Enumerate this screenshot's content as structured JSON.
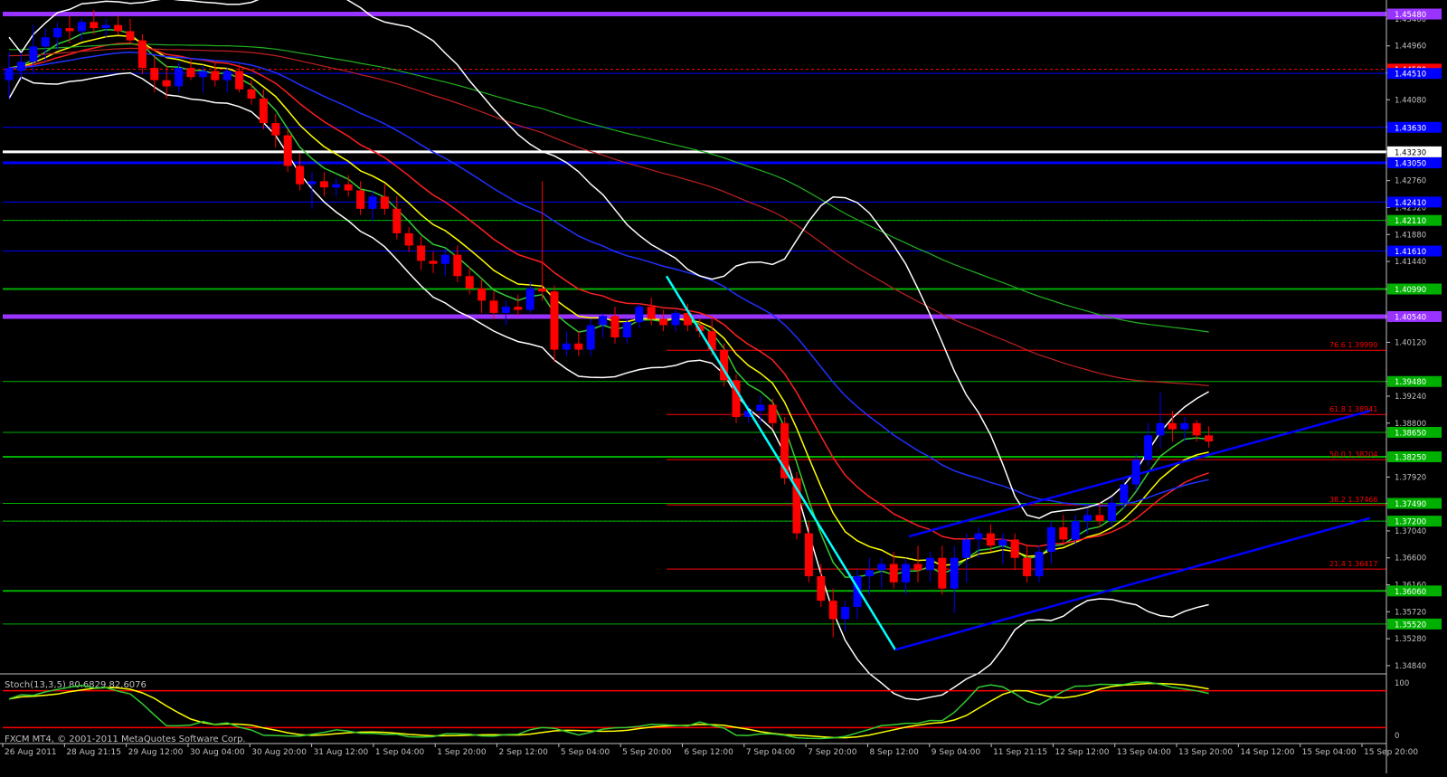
{
  "platform": {
    "watermark": "FXCM MT4, © 2001-2011 MetaQuotes Software Corp."
  },
  "colors": {
    "background": "#000000",
    "bull_candle": "#0000ff",
    "bear_candle": "#ff0000",
    "purple_level": "#9933ff",
    "blue_level": "#0000ff",
    "green_level": "#00b000",
    "white_level": "#ffffff",
    "fib_line": "#ff0000",
    "trendline_cyan": "#00ffff",
    "channel_blue": "#0000ff",
    "stoch_main": "#32cd32",
    "stoch_signal": "#ffff00"
  },
  "chart_data": [
    {
      "type": "candlestick",
      "grid": false,
      "ylim": [
        1.3475,
        1.4565
      ],
      "price_ticks": [
        "1.45400",
        "1.44960",
        "1.44520",
        "1.44080",
        "1.43640",
        "1.43230",
        "1.42760",
        "1.42320",
        "1.41880",
        "1.41440",
        "1.40990",
        "1.40540",
        "1.40120",
        "1.39480",
        "1.39240",
        "1.38800",
        "1.37920",
        "1.37490",
        "1.37040",
        "1.36600",
        "1.36160",
        "1.35720",
        "1.35280",
        "1.34840"
      ],
      "time_labels": [
        "26 Aug 2011",
        "28 Aug 21:15",
        "29 Aug 12:00",
        "30 Aug 04:00",
        "30 Aug 20:00",
        "31 Aug 12:00",
        "1 Sep 04:00",
        "1 Sep 20:00",
        "2 Sep 12:00",
        "5 Sep 04:00",
        "5 Sep 20:00",
        "6 Sep 12:00",
        "7 Sep 04:00",
        "7 Sep 20:00",
        "8 Sep 12:00",
        "9 Sep 04:00",
        "11 Sep 21:15",
        "12 Sep 12:00",
        "13 Sep 04:00",
        "13 Sep 20:00",
        "14 Sep 12:00",
        "15 Sep 04:00",
        "15 Sep 20:00"
      ],
      "candles": [
        [
          1.444,
          1.4485,
          1.441,
          1.446
        ],
        [
          1.4455,
          1.4485,
          1.444,
          1.447
        ],
        [
          1.447,
          1.453,
          1.445,
          1.4495
        ],
        [
          1.4495,
          1.4525,
          1.447,
          1.451
        ],
        [
          1.451,
          1.4535,
          1.449,
          1.4525
        ],
        [
          1.4525,
          1.4545,
          1.45,
          1.452
        ],
        [
          1.452,
          1.454,
          1.4505,
          1.4535
        ],
        [
          1.4535,
          1.4555,
          1.4515,
          1.4525
        ],
        [
          1.4525,
          1.454,
          1.451,
          1.453
        ],
        [
          1.453,
          1.4545,
          1.4515,
          1.452
        ],
        [
          1.452,
          1.454,
          1.45,
          1.4505
        ],
        [
          1.4505,
          1.4515,
          1.445,
          1.446
        ],
        [
          1.446,
          1.448,
          1.442,
          1.444
        ],
        [
          1.444,
          1.4465,
          1.441,
          1.443
        ],
        [
          1.443,
          1.447,
          1.442,
          1.446
        ],
        [
          1.446,
          1.4475,
          1.444,
          1.4445
        ],
        [
          1.4445,
          1.4465,
          1.442,
          1.4455
        ],
        [
          1.4455,
          1.447,
          1.443,
          1.444
        ],
        [
          1.444,
          1.446,
          1.442,
          1.4455
        ],
        [
          1.4455,
          1.4465,
          1.442,
          1.4425
        ],
        [
          1.4425,
          1.444,
          1.44,
          1.441
        ],
        [
          1.441,
          1.4425,
          1.436,
          1.437
        ],
        [
          1.437,
          1.4385,
          1.433,
          1.435
        ],
        [
          1.435,
          1.436,
          1.429,
          1.43
        ],
        [
          1.43,
          1.432,
          1.426,
          1.427
        ],
        [
          1.427,
          1.429,
          1.423,
          1.4275
        ],
        [
          1.4275,
          1.429,
          1.425,
          1.4265
        ],
        [
          1.4265,
          1.428,
          1.425,
          1.427
        ],
        [
          1.427,
          1.4285,
          1.425,
          1.426
        ],
        [
          1.426,
          1.4275,
          1.422,
          1.423
        ],
        [
          1.423,
          1.426,
          1.421,
          1.425
        ],
        [
          1.425,
          1.427,
          1.422,
          1.423
        ],
        [
          1.423,
          1.425,
          1.418,
          1.419
        ],
        [
          1.419,
          1.42,
          1.416,
          1.417
        ],
        [
          1.417,
          1.4185,
          1.413,
          1.4145
        ],
        [
          1.4145,
          1.416,
          1.4125,
          1.414
        ],
        [
          1.414,
          1.4165,
          1.412,
          1.4155
        ],
        [
          1.4155,
          1.417,
          1.411,
          1.412
        ],
        [
          1.412,
          1.4135,
          1.409,
          1.41
        ],
        [
          1.41,
          1.4115,
          1.406,
          1.408
        ],
        [
          1.408,
          1.4095,
          1.405,
          1.406
        ],
        [
          1.406,
          1.408,
          1.404,
          1.407
        ],
        [
          1.407,
          1.409,
          1.4055,
          1.4065
        ],
        [
          1.4065,
          1.411,
          1.406,
          1.41
        ],
        [
          1.41,
          1.4275,
          1.408,
          1.4095
        ],
        [
          1.4095,
          1.4105,
          1.398,
          1.4
        ],
        [
          1.4,
          1.403,
          1.399,
          1.401
        ],
        [
          1.401,
          1.403,
          1.399,
          1.4
        ],
        [
          1.4,
          1.405,
          1.399,
          1.404
        ],
        [
          1.404,
          1.406,
          1.402,
          1.4055
        ],
        [
          1.4055,
          1.407,
          1.401,
          1.402
        ],
        [
          1.402,
          1.405,
          1.401,
          1.4045
        ],
        [
          1.4045,
          1.4075,
          1.4035,
          1.407
        ],
        [
          1.407,
          1.4085,
          1.404,
          1.405
        ],
        [
          1.405,
          1.4065,
          1.403,
          1.404
        ],
        [
          1.404,
          1.4065,
          1.403,
          1.406
        ],
        [
          1.406,
          1.4075,
          1.403,
          1.404
        ],
        [
          1.404,
          1.405,
          1.402,
          1.403
        ],
        [
          1.403,
          1.405,
          1.399,
          1.4
        ],
        [
          1.4,
          1.401,
          1.394,
          1.395
        ],
        [
          1.395,
          1.396,
          1.388,
          1.389
        ],
        [
          1.389,
          1.391,
          1.388,
          1.39
        ],
        [
          1.39,
          1.3925,
          1.388,
          1.391
        ],
        [
          1.391,
          1.392,
          1.387,
          1.388
        ],
        [
          1.388,
          1.389,
          1.378,
          1.379
        ],
        [
          1.379,
          1.38,
          1.369,
          1.37
        ],
        [
          1.37,
          1.372,
          1.362,
          1.363
        ],
        [
          1.363,
          1.365,
          1.358,
          1.359
        ],
        [
          1.359,
          1.361,
          1.353,
          1.356
        ],
        [
          1.356,
          1.359,
          1.354,
          1.358
        ],
        [
          1.358,
          1.364,
          1.356,
          1.363
        ],
        [
          1.363,
          1.366,
          1.36,
          1.364
        ],
        [
          1.364,
          1.366,
          1.361,
          1.365
        ],
        [
          1.365,
          1.367,
          1.361,
          1.362
        ],
        [
          1.362,
          1.366,
          1.36,
          1.365
        ],
        [
          1.365,
          1.368,
          1.362,
          1.364
        ],
        [
          1.364,
          1.367,
          1.362,
          1.366
        ],
        [
          1.366,
          1.368,
          1.36,
          1.361
        ],
        [
          1.361,
          1.368,
          1.357,
          1.366
        ],
        [
          1.366,
          1.37,
          1.362,
          1.369
        ],
        [
          1.369,
          1.371,
          1.366,
          1.37
        ],
        [
          1.37,
          1.3715,
          1.367,
          1.368
        ],
        [
          1.368,
          1.37,
          1.365,
          1.369
        ],
        [
          1.369,
          1.37,
          1.364,
          1.366
        ],
        [
          1.366,
          1.368,
          1.362,
          1.363
        ],
        [
          1.363,
          1.368,
          1.362,
          1.367
        ],
        [
          1.367,
          1.372,
          1.365,
          1.371
        ],
        [
          1.371,
          1.373,
          1.368,
          1.369
        ],
        [
          1.369,
          1.373,
          1.368,
          1.372
        ],
        [
          1.372,
          1.374,
          1.37,
          1.373
        ],
        [
          1.373,
          1.375,
          1.371,
          1.372
        ],
        [
          1.372,
          1.376,
          1.371,
          1.375
        ],
        [
          1.375,
          1.379,
          1.374,
          1.378
        ],
        [
          1.378,
          1.383,
          1.377,
          1.382
        ],
        [
          1.382,
          1.388,
          1.381,
          1.386
        ],
        [
          1.386,
          1.393,
          1.384,
          1.388
        ],
        [
          1.388,
          1.39,
          1.385,
          1.387
        ],
        [
          1.387,
          1.389,
          1.385,
          1.388
        ],
        [
          1.388,
          1.3885,
          1.385,
          1.386
        ],
        [
          1.386,
          1.3875,
          1.384,
          1.385
        ]
      ],
      "right_axis_tags": [
        {
          "price": "1.45480",
          "color": "#9933ff"
        },
        {
          "price": "1.44580",
          "color": "#ff0000"
        },
        {
          "price": "1.44510",
          "color": "#0000ff"
        },
        {
          "price": "1.43630",
          "color": "#0000ff"
        },
        {
          "price": "1.43230",
          "color": "#ffffff"
        },
        {
          "price": "1.43050",
          "color": "#0000ff"
        },
        {
          "price": "1.42410",
          "color": "#0000ff"
        },
        {
          "price": "1.42110",
          "color": "#00b000"
        },
        {
          "price": "1.41610",
          "color": "#0000ff"
        },
        {
          "price": "1.40990",
          "color": "#00b000"
        },
        {
          "price": "1.40540",
          "color": "#9933ff"
        },
        {
          "price": "1.39480",
          "color": "#00b000"
        },
        {
          "price": "1.38650",
          "color": "#00b000"
        },
        {
          "price": "1.38250",
          "color": "#00b000"
        },
        {
          "price": "1.37490",
          "color": "#00b000"
        },
        {
          "price": "1.37200",
          "color": "#00b000"
        },
        {
          "price": "1.36060",
          "color": "#00b000"
        },
        {
          "price": "1.35520",
          "color": "#00b000"
        }
      ],
      "fibonacci": [
        {
          "level": "76.6",
          "price": "1.39990"
        },
        {
          "level": "61.8",
          "price": "1.38941"
        },
        {
          "level": "50.0",
          "price": "1.38204"
        },
        {
          "level": "38.2",
          "price": "1.37466"
        },
        {
          "level": "21.4",
          "price": "1.36417"
        }
      ]
    },
    {
      "type": "line",
      "title": "Stoch(13,3,5) 80.6829 82.6076",
      "ylim": [
        0,
        100
      ],
      "levels": [
        80,
        20
      ],
      "axis_labels": [
        "100",
        "0"
      ]
    }
  ]
}
